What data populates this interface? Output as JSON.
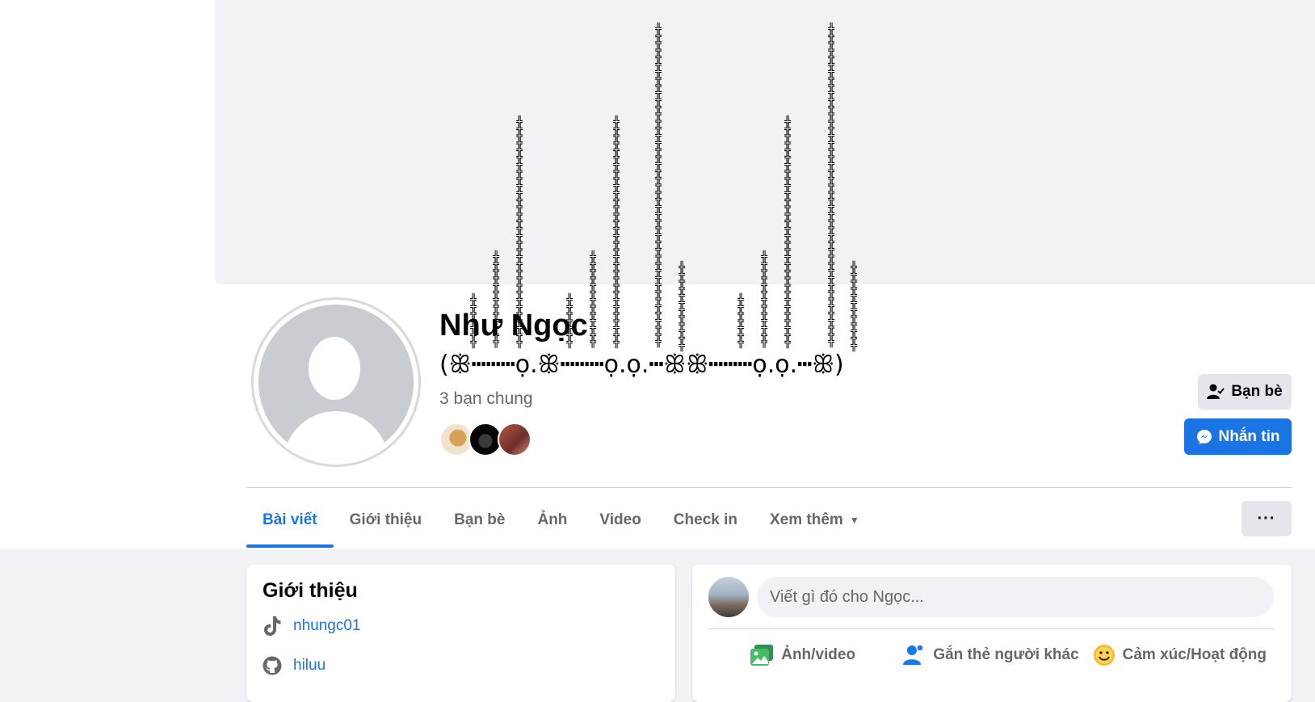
{
  "profile": {
    "name": "Như Ngọc",
    "decoration": "(ꕥ┅┅┅ọ.ꕥ┅┅┅ọ.ọ.┅ꕥꕥ┅┅┅ọ.ọ.┅ꕥ)",
    "mutual_friends": "3 bạn chung",
    "spike_glyph": "╬"
  },
  "actions": {
    "friends_label": "Bạn bè",
    "message_label": "Nhắn tin",
    "more_label": "···"
  },
  "tabs": [
    {
      "label": "Bài viết",
      "active": true
    },
    {
      "label": "Giới thiệu"
    },
    {
      "label": "Bạn bè"
    },
    {
      "label": "Ảnh"
    },
    {
      "label": "Video"
    },
    {
      "label": "Check in"
    },
    {
      "label": "Xem thêm"
    }
  ],
  "intro": {
    "title": "Giới thiệu",
    "links": [
      {
        "icon": "tiktok-icon",
        "text": "nhungc01"
      },
      {
        "icon": "github-icon",
        "text": "hiluu"
      }
    ]
  },
  "composer": {
    "placeholder": "Viết gì đó cho Ngọc...",
    "actions": [
      {
        "icon": "photo-video-icon",
        "label": "Ảnh/video"
      },
      {
        "icon": "tag-people-icon",
        "label": "Gắn thẻ người khác"
      },
      {
        "icon": "feeling-icon",
        "label": "Cảm xúc/Hoạt động"
      }
    ]
  },
  "colors": {
    "accent": "#1b74e4",
    "secondary_text": "#65676b",
    "page_bg": "#f0f2f5"
  }
}
